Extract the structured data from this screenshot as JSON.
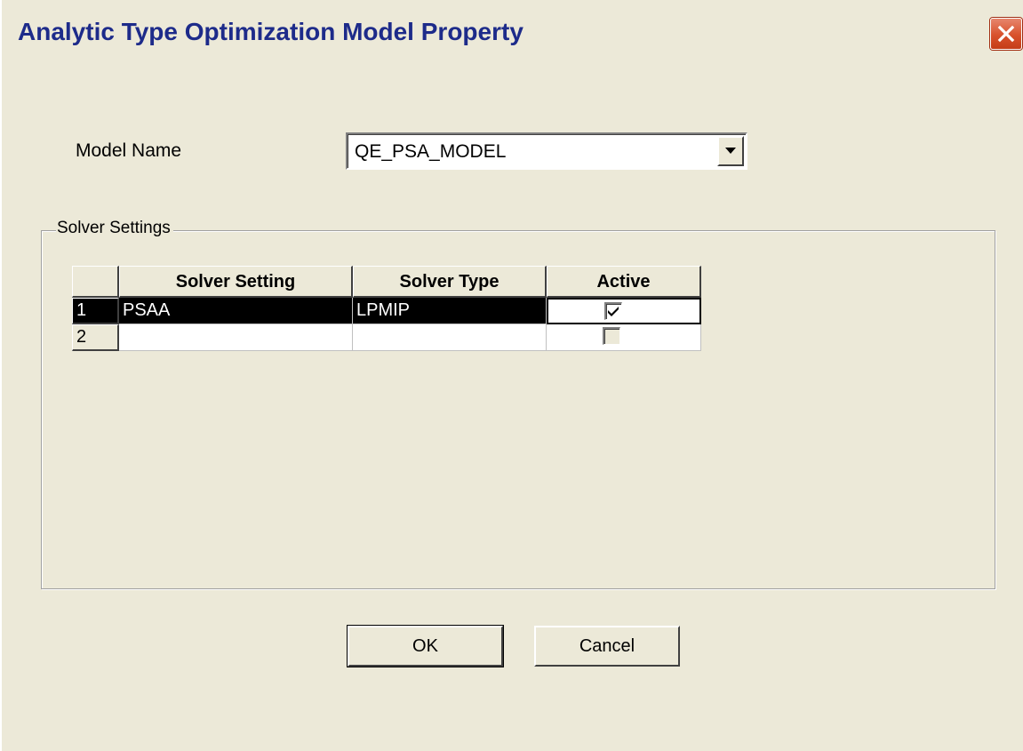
{
  "window": {
    "title": "Analytic Type Optimization Model Property"
  },
  "icons": {
    "close": "close-icon",
    "dropdown": "chevron-down-icon",
    "check": "checkmark-icon"
  },
  "colors": {
    "title_text": "#1d2b8a",
    "close_button": "#d8512c",
    "dialog_bg": "#ece9d8",
    "selection": "#000000"
  },
  "form": {
    "model_name_label": "Model Name",
    "model_name_value": "QE_PSA_MODEL"
  },
  "solver_settings": {
    "group_label": "Solver Settings",
    "columns": [
      "Solver Setting",
      "Solver Type",
      "Active"
    ],
    "rows": [
      {
        "num": "1",
        "setting": "PSAA",
        "type": "LPMIP",
        "active": true,
        "selected": true
      },
      {
        "num": "2",
        "setting": "",
        "type": "",
        "active": false,
        "selected": false
      }
    ]
  },
  "buttons": {
    "ok": "OK",
    "cancel": "Cancel"
  }
}
